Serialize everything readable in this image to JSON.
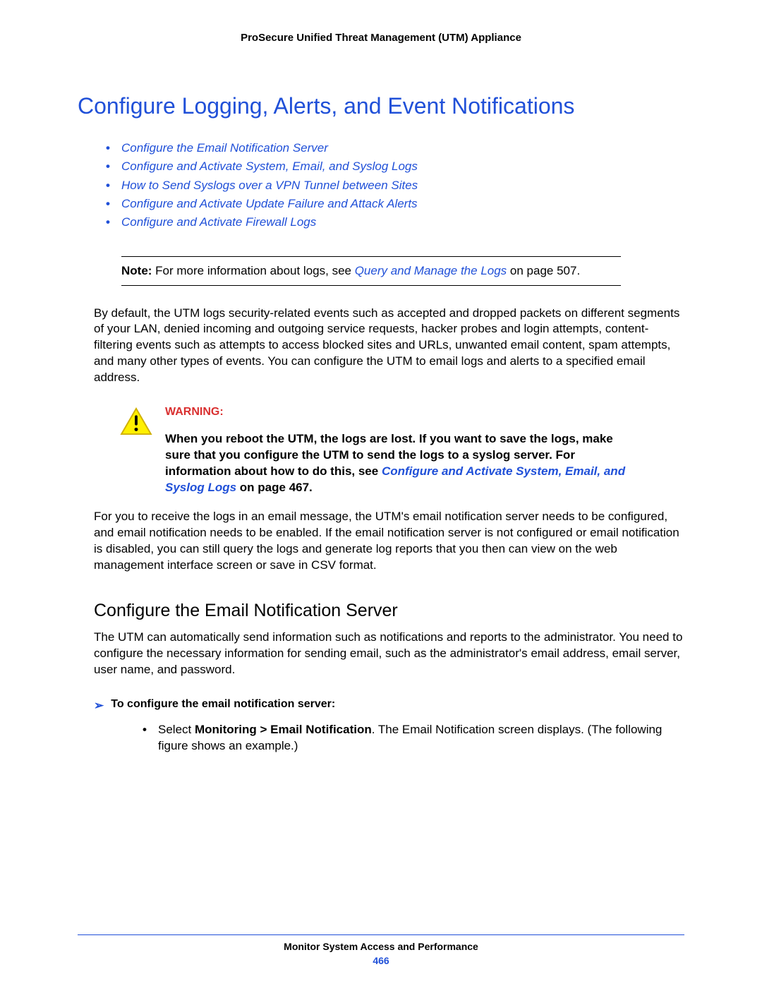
{
  "running_header": "ProSecure Unified Threat Management (UTM) Appliance",
  "main_title": "Configure Logging, Alerts, and Event Notifications",
  "toc": [
    "Configure the Email Notification Server",
    "Configure and Activate System, Email, and Syslog Logs",
    "How to Send Syslogs over a VPN Tunnel between Sites",
    "Configure and Activate Update Failure and Attack Alerts",
    "Configure and Activate Firewall Logs"
  ],
  "note": {
    "label": "Note:",
    "pre": " For more information about logs, see ",
    "link": "Query and Manage the Logs",
    "post": " on page 507."
  },
  "para1": "By default, the UTM logs security-related events such as accepted and dropped packets on different segments of your LAN, denied incoming and outgoing service requests, hacker probes and login attempts, content-filtering events such as attempts to access blocked sites and URLs, unwanted email content, spam attempts, and many other types of events. You can configure the UTM to email logs and alerts to a specified email address.",
  "warning": {
    "title": "WARNING:",
    "text_pre": "When you reboot the UTM, the logs are lost. If you want to save the logs, make sure that you configure the UTM to send the logs to a syslog server. For information about how to do this, see ",
    "link": "Configure and Activate System, Email, and Syslog Logs",
    "text_post": " on page 467."
  },
  "para2": "For you to receive the logs in an email message, the UTM's email notification server needs to be configured, and email notification needs to be enabled. If the email notification server is not configured or email notification is disabled, you can still query the logs and generate log reports that you then can view on the web management interface screen or save in CSV format.",
  "sub_heading": "Configure the Email Notification Server",
  "para3": "The UTM can automatically send information such as notifications and reports to the administrator. You need to configure the necessary information for sending email, such as the administrator's email address, email server, user name, and password.",
  "proc_heading": "To configure the email notification server:",
  "step": {
    "prefix": "Select ",
    "strong": "Monitoring > Email Notification",
    "suffix": ". The Email Notification screen displays. (The following figure shows an example.)"
  },
  "footer": {
    "text": "Monitor System Access and Performance",
    "page": "466"
  }
}
